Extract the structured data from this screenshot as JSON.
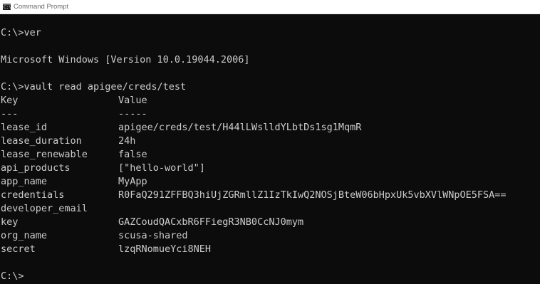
{
  "window": {
    "title": "Command Prompt",
    "icon": "command-prompt-icon",
    "icon_glyph": "C:\\"
  },
  "console": {
    "cmd_ver": "C:\\>ver",
    "ver_output": "Microsoft Windows [Version 10.0.19044.2006]",
    "cmd_vault": "C:\\>vault read apigee/creds/test",
    "header": {
      "key": "Key",
      "value": "Value"
    },
    "separator": {
      "key": "---",
      "value": "-----"
    },
    "rows": [
      {
        "key": "lease_id",
        "value": "apigee/creds/test/H44lLWslldYLbtDs1sg1MqmR"
      },
      {
        "key": "lease_duration",
        "value": "24h"
      },
      {
        "key": "lease_renewable",
        "value": "false"
      },
      {
        "key": "api_products",
        "value": "[\"hello-world\"]"
      },
      {
        "key": "app_name",
        "value": "MyApp"
      },
      {
        "key": "credentials",
        "value": "R0FaQ291ZFFBQ3hiUjZGRmllZ1IzTkIwQ2NOSjBteW06bHpxUk5vbXVlWNpOE5FSA=="
      },
      {
        "key": "developer_email",
        "value": ""
      },
      {
        "key": "key",
        "value": "GAZCoudQACxbR6FFiegR3NB0CcNJ0mym"
      },
      {
        "key": "org_name",
        "value": "scusa-shared"
      },
      {
        "key": "secret",
        "value": "lzqRNomueYci8NEH"
      }
    ],
    "prompt": "C:\\>"
  },
  "colors": {
    "background": "#0c0c0c",
    "foreground": "#cccccc",
    "titlebar": "#ffffff"
  }
}
